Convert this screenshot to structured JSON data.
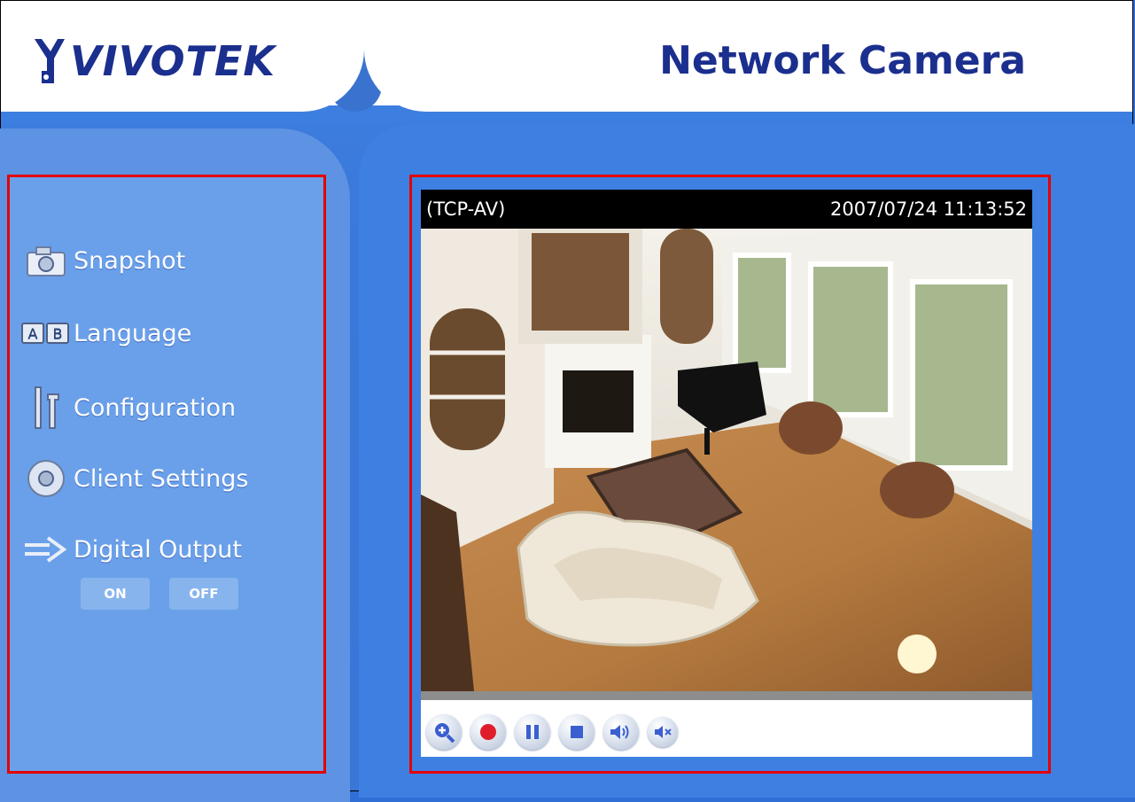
{
  "header": {
    "logo_text": "VIVOTEK",
    "app_title": "Network Camera"
  },
  "sidebar": {
    "items": [
      {
        "label": "Snapshot",
        "icon": "camera-icon"
      },
      {
        "label": "Language",
        "icon": "language-icon"
      },
      {
        "label": "Configuration",
        "icon": "wrench-icon"
      },
      {
        "label": "Client Settings",
        "icon": "client-settings-icon"
      },
      {
        "label": "Digital Output",
        "icon": "digital-output-icon"
      }
    ],
    "digital_output": {
      "on_label": "ON",
      "off_label": "OFF"
    }
  },
  "video": {
    "protocol": "(TCP-AV)",
    "timestamp": "2007/07/24 11:13:52",
    "controls": [
      "zoom-in-icon",
      "record-icon",
      "pause-icon",
      "stop-icon",
      "speaker-icon",
      "mute-icon"
    ]
  },
  "colors": {
    "brand": "#1b2f8e",
    "background": "#3d7fe0",
    "highlight_border": "#e40000"
  }
}
